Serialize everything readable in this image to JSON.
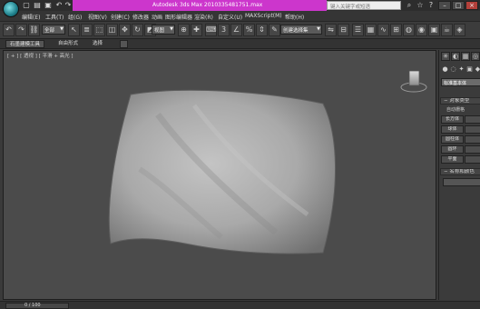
{
  "window": {
    "app_title": "Autodesk 3ds Max  2010",
    "file_name": "335481751.max",
    "search_placeholder": "键入关键字或短语",
    "logo_icon": "3dsmax-logo-icon"
  },
  "menu": {
    "items": [
      "编辑(E)",
      "工具(T)",
      "组(G)",
      "视图(V)",
      "创建(C)",
      "修改器",
      "动画",
      "图形编辑器",
      "渲染(R)",
      "自定义(U)",
      "MAXScript(M)",
      "帮助(H)"
    ]
  },
  "toolbar": {
    "selection_filter": "全部",
    "reference_coord": "视图",
    "named_selection": "创建选择集"
  },
  "ribbon": {
    "tabs": [
      "石墨建模工具",
      "自由形式",
      "选择"
    ]
  },
  "viewport": {
    "label": "[ + ] [ 透视 ] [ 平滑 + 高光 ]",
    "background_color": "#4b4b4b",
    "object_color": "#a9a9a9"
  },
  "command_panel": {
    "category_dropdown": "标准基本体",
    "rollout_object_type": "对象类型",
    "autogrid_label": "自动栅格",
    "buttons": [
      "长方体",
      "球体",
      "圆柱体",
      "圆环",
      "平面"
    ],
    "rollout_name_color": "名称和颜色"
  },
  "status": {
    "time_slider": "0 / 100"
  }
}
